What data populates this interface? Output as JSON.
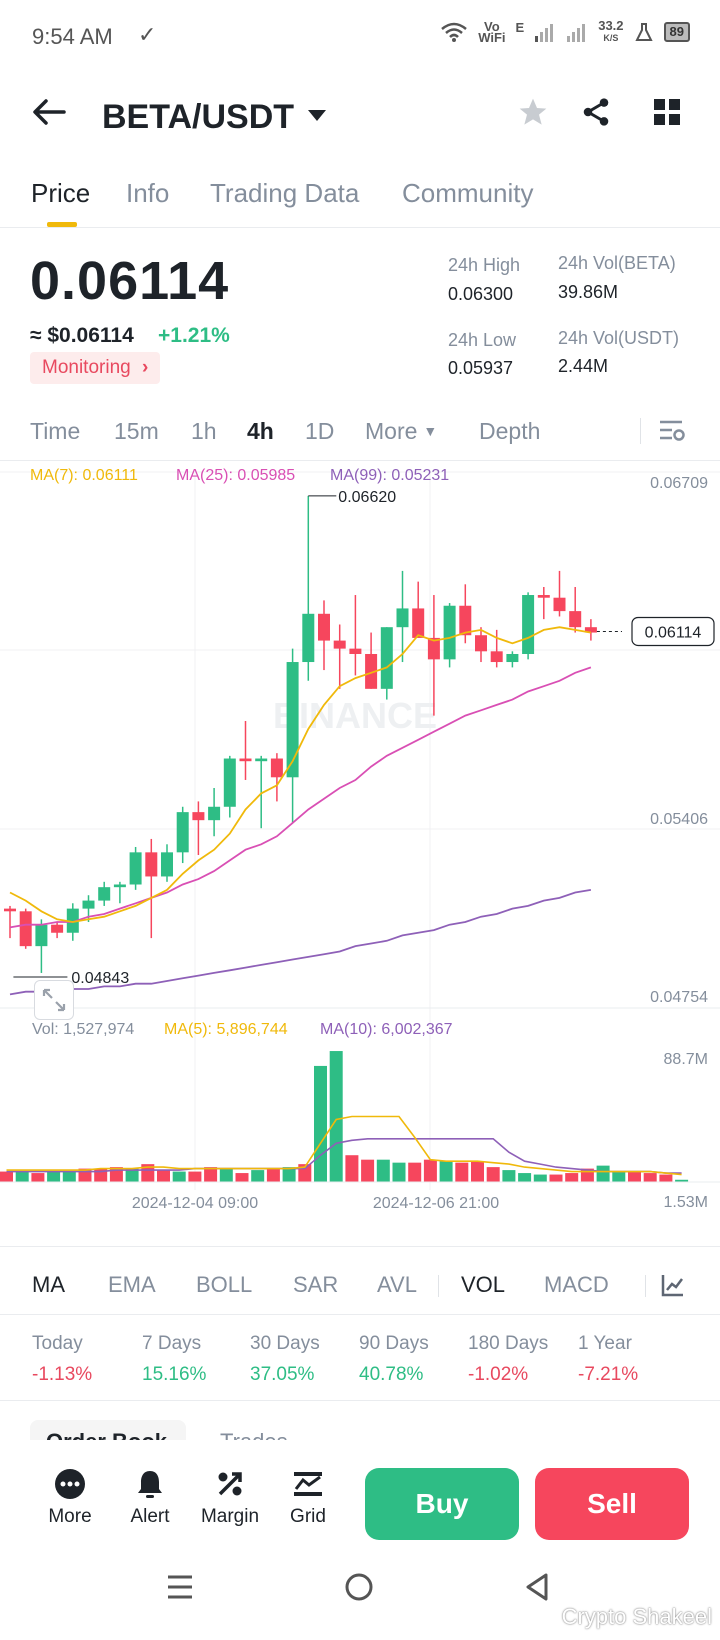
{
  "status_bar": {
    "time": "9:54 AM",
    "network_speed": "33.2",
    "network_unit": "K/S",
    "network_label_top": "Vo",
    "network_label_bottom": "WiFi",
    "network_e": "E",
    "battery": "89"
  },
  "header": {
    "pair": "BETA/USDT"
  },
  "tabs": [
    {
      "label": "Price"
    },
    {
      "label": "Info"
    },
    {
      "label": "Trading Data"
    },
    {
      "label": "Community"
    }
  ],
  "ticker": {
    "price": "0.06114",
    "usd_price": "≈ $0.06114",
    "change": "+1.21%",
    "monitoring": "Monitoring",
    "high_label": "24h High",
    "high_value": "0.06300",
    "low_label": "24h Low",
    "low_value": "0.05937",
    "vol_base_label": "24h Vol(BETA)",
    "vol_base_value": "39.86M",
    "vol_quote_label": "24h Vol(USDT)",
    "vol_quote_value": "2.44M"
  },
  "intervals": [
    {
      "label": "Time"
    },
    {
      "label": "15m"
    },
    {
      "label": "1h"
    },
    {
      "label": "4h"
    },
    {
      "label": "1D"
    },
    {
      "label": "More"
    },
    {
      "label": "Depth"
    }
  ],
  "chart_data": {
    "type": "candlestick",
    "ma_legend": {
      "ma7": "MA(7): 0.06111",
      "ma25": "MA(25): 0.05985",
      "ma99": "MA(99): 0.05231"
    },
    "price_axis": [
      "0.06709",
      "0.05406",
      "0.04754"
    ],
    "current_price_label": "0.06114",
    "high_marker": "0.06620",
    "low_marker": "0.04843",
    "watermark": "BINANCE",
    "volume_legend": {
      "vol": "Vol: 1,527,974",
      "ma5": "MA(5): 5,896,744",
      "ma10": "MA(10): 6,002,367"
    },
    "volume_axis": [
      "88.7M",
      "1.53M"
    ],
    "x_labels": [
      "2024-12-04 09:00",
      "2024-12-06 21:00"
    ],
    "colors": {
      "up": "#2ebd85",
      "down": "#f6465d",
      "ma7": "#f0b90b",
      "ma25": "#d94fb4",
      "ma99": "#8e60b8"
    },
    "candles": [
      [
        0.0508,
        0.0509,
        0.0497,
        0.0507
      ],
      [
        0.0507,
        0.0508,
        0.0493,
        0.0494
      ],
      [
        0.0494,
        0.0504,
        0.0484,
        0.0502
      ],
      [
        0.0502,
        0.0503,
        0.0497,
        0.0499
      ],
      [
        0.0499,
        0.051,
        0.0496,
        0.0508
      ],
      [
        0.0508,
        0.0513,
        0.0503,
        0.0511
      ],
      [
        0.0511,
        0.0518,
        0.0509,
        0.0516
      ],
      [
        0.0516,
        0.0518,
        0.051,
        0.0517
      ],
      [
        0.0517,
        0.0531,
        0.0515,
        0.0529
      ],
      [
        0.0529,
        0.0534,
        0.0497,
        0.052
      ],
      [
        0.052,
        0.0532,
        0.0518,
        0.0529
      ],
      [
        0.0529,
        0.0546,
        0.0525,
        0.0544
      ],
      [
        0.0544,
        0.0548,
        0.0528,
        0.0541
      ],
      [
        0.0541,
        0.0553,
        0.0535,
        0.0546
      ],
      [
        0.0546,
        0.0565,
        0.0542,
        0.0564
      ],
      [
        0.0564,
        0.0578,
        0.0556,
        0.0563
      ],
      [
        0.0563,
        0.0565,
        0.0538,
        0.0564
      ],
      [
        0.0564,
        0.0566,
        0.0548,
        0.0557
      ],
      [
        0.0557,
        0.0605,
        0.054,
        0.06
      ],
      [
        0.06,
        0.0662,
        0.0593,
        0.0618
      ],
      [
        0.0618,
        0.0623,
        0.0597,
        0.0608
      ],
      [
        0.0608,
        0.0614,
        0.059,
        0.0605
      ],
      [
        0.0605,
        0.0625,
        0.0595,
        0.0603
      ],
      [
        0.0603,
        0.0611,
        0.059,
        0.059
      ],
      [
        0.059,
        0.0613,
        0.0586,
        0.0613
      ],
      [
        0.0613,
        0.0634,
        0.06,
        0.062
      ],
      [
        0.062,
        0.063,
        0.0612,
        0.0609
      ],
      [
        0.0609,
        0.0625,
        0.058,
        0.0601
      ],
      [
        0.0601,
        0.0622,
        0.0598,
        0.0621
      ],
      [
        0.0621,
        0.0629,
        0.0607,
        0.061
      ],
      [
        0.061,
        0.0613,
        0.06,
        0.0604
      ],
      [
        0.0604,
        0.0612,
        0.0598,
        0.06
      ],
      [
        0.06,
        0.0604,
        0.0598,
        0.0603
      ],
      [
        0.0603,
        0.0626,
        0.0601,
        0.0625
      ],
      [
        0.0625,
        0.0628,
        0.0616,
        0.0624
      ],
      [
        0.0624,
        0.0634,
        0.0617,
        0.0619
      ],
      [
        0.0619,
        0.0628,
        0.0611,
        0.0613
      ],
      [
        0.0613,
        0.0616,
        0.0608,
        0.0611
      ]
    ],
    "ma7": [
      0.0514,
      0.0511,
      0.0507,
      0.0504,
      0.0503,
      0.0504,
      0.0505,
      0.0507,
      0.0509,
      0.0512,
      0.0515,
      0.0521,
      0.0526,
      0.053,
      0.0536,
      0.0545,
      0.0551,
      0.0554,
      0.0563,
      0.0575,
      0.0584,
      0.0591,
      0.0594,
      0.0596,
      0.0598,
      0.0603,
      0.061,
      0.0608,
      0.0609,
      0.0611,
      0.0612,
      0.0609,
      0.0607,
      0.0609,
      0.0612,
      0.0613,
      0.0612,
      0.0611
    ],
    "ma25": [
      0.0501,
      0.0502,
      0.0502,
      0.0503,
      0.0503,
      0.0505,
      0.0506,
      0.0508,
      0.051,
      0.0512,
      0.0514,
      0.0517,
      0.0519,
      0.0522,
      0.0526,
      0.053,
      0.0532,
      0.0535,
      0.054,
      0.0545,
      0.0549,
      0.0553,
      0.0556,
      0.0561,
      0.0565,
      0.0568,
      0.0571,
      0.0574,
      0.0577,
      0.058,
      0.0582,
      0.0584,
      0.0586,
      0.0589,
      0.0591,
      0.0593,
      0.0596,
      0.0598
    ],
    "ma99": [
      0.0476,
      0.0477,
      0.0477,
      0.0478,
      0.0478,
      0.0478,
      0.0479,
      0.0479,
      0.048,
      0.048,
      0.0481,
      0.0482,
      0.0483,
      0.0484,
      0.0485,
      0.0486,
      0.0487,
      0.0488,
      0.0489,
      0.049,
      0.0491,
      0.0492,
      0.0494,
      0.0495,
      0.0496,
      0.0498,
      0.0499,
      0.05,
      0.0502,
      0.0503,
      0.0505,
      0.0506,
      0.0508,
      0.0509,
      0.0511,
      0.0512,
      0.0514,
      0.0515
    ],
    "volumes": [
      7,
      7,
      6,
      7,
      7,
      9,
      9,
      10,
      9,
      12,
      8,
      7,
      7,
      10,
      9,
      6,
      8,
      9,
      10,
      12,
      78,
      88,
      18,
      15,
      15,
      13,
      13,
      15,
      14,
      13,
      14,
      10,
      8,
      6,
      5,
      5,
      6,
      9,
      11,
      7,
      7,
      6,
      5,
      1.5
    ],
    "vol_ma5": [
      8,
      8,
      8,
      8,
      8,
      8,
      9,
      9,
      9,
      10,
      10,
      9,
      9,
      9,
      9,
      9,
      9,
      9,
      9,
      10,
      26,
      42,
      44,
      44,
      44,
      44,
      30,
      15,
      14,
      14,
      14,
      13,
      12,
      10,
      9,
      8,
      7,
      7,
      7,
      7,
      7,
      7,
      6,
      5
    ],
    "vol_ma10": [
      7,
      7,
      7,
      7,
      7,
      7,
      7,
      8,
      8,
      8,
      8,
      8,
      9,
      9,
      9,
      9,
      9,
      9,
      9,
      9,
      18,
      26,
      28,
      29,
      29,
      29,
      29,
      29,
      29,
      29,
      29,
      29,
      20,
      14,
      12,
      10,
      9,
      8,
      7,
      7,
      7,
      7,
      6,
      6
    ]
  },
  "indicators": [
    {
      "label": "MA"
    },
    {
      "label": "EMA"
    },
    {
      "label": "BOLL"
    },
    {
      "label": "SAR"
    },
    {
      "label": "AVL"
    },
    {
      "label": "VOL"
    },
    {
      "label": "MACD"
    }
  ],
  "performance": [
    {
      "label": "Today",
      "value": "-1.13%"
    },
    {
      "label": "7 Days",
      "value": "15.16%"
    },
    {
      "label": "30 Days",
      "value": "37.05%"
    },
    {
      "label": "90 Days",
      "value": "40.78%"
    },
    {
      "label": "180 Days",
      "value": "-1.02%"
    },
    {
      "label": "1 Year",
      "value": "-7.21%"
    }
  ],
  "orderbook_tabs": [
    {
      "label": "Order Book"
    },
    {
      "label": "Trades"
    }
  ],
  "bottom_bar": {
    "more": "More",
    "alert": "Alert",
    "margin": "Margin",
    "grid": "Grid",
    "buy": "Buy",
    "sell": "Sell"
  },
  "watermark": "Crypto Shakeel"
}
